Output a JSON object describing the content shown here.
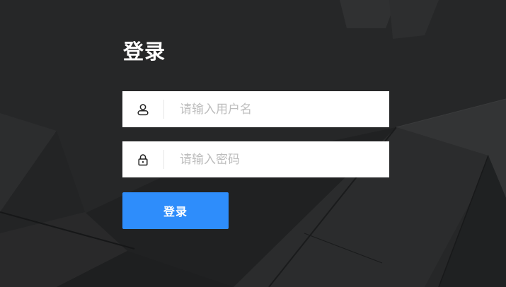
{
  "login": {
    "title": "登录",
    "username": {
      "icon": "user-icon",
      "placeholder": "请输入用户名",
      "value": ""
    },
    "password": {
      "icon": "lock-icon",
      "placeholder": "请输入密码",
      "value": ""
    },
    "submit_label": "登录"
  },
  "colors": {
    "background": "#262728",
    "field_background": "#ffffff",
    "placeholder": "#bdbdbd",
    "button": "#2e8dfb",
    "button_text": "#ffffff",
    "title": "#ffffff"
  }
}
